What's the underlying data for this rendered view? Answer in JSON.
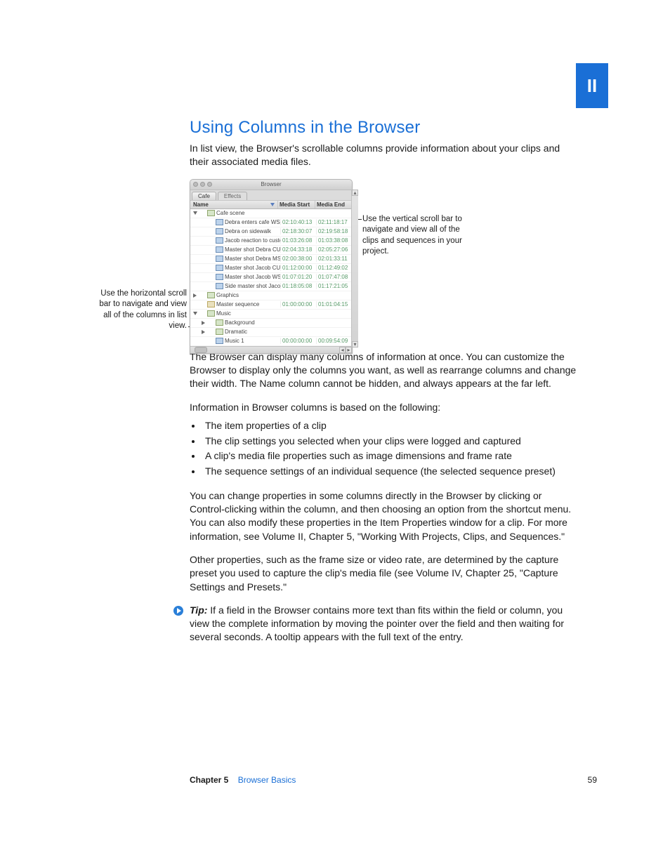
{
  "section_number": "II",
  "heading": "Using Columns in the Browser",
  "intro": "In list view, the Browser's scrollable columns provide information about your clips and their associated media files.",
  "callouts": {
    "left": "Use the horizontal scroll bar to navigate and view all of the columns in list view.",
    "right": "Use the vertical scroll bar to navigate and view all of the clips and sequences in your project."
  },
  "browser": {
    "window_title": "Browser",
    "tabs": [
      "Cafe",
      "Effects"
    ],
    "columns": {
      "name": "Name",
      "media_start": "Media Start",
      "media_end": "Media End"
    },
    "rows": [
      {
        "indent": 0,
        "tri": "down",
        "icon": "bin",
        "name": "Cafe scene",
        "start": "",
        "end": ""
      },
      {
        "indent": 1,
        "tri": "",
        "icon": "clip",
        "name": "Debra enters cafe WS",
        "start": "02:10:40:13",
        "end": "02:11:18:17"
      },
      {
        "indent": 1,
        "tri": "",
        "icon": "clip",
        "name": "Debra on sidewalk",
        "start": "02:18:30:07",
        "end": "02:19:58:18"
      },
      {
        "indent": 1,
        "tri": "",
        "icon": "clip",
        "name": "Jacob reaction to customer CU",
        "start": "01:03:26:08",
        "end": "01:03:38:08"
      },
      {
        "indent": 1,
        "tri": "",
        "icon": "clip",
        "name": "Master shot Debra CU",
        "start": "02:04:33:18",
        "end": "02:05:27:06"
      },
      {
        "indent": 1,
        "tri": "",
        "icon": "clip",
        "name": "Master shot Debra MS",
        "start": "02:00:38:00",
        "end": "02:01:33:11"
      },
      {
        "indent": 1,
        "tri": "",
        "icon": "clip",
        "name": "Master shot Jacob CU",
        "start": "01:12:00:00",
        "end": "01:12:49:02"
      },
      {
        "indent": 1,
        "tri": "",
        "icon": "clip",
        "name": "Master shot Jacob WS",
        "start": "01:07:01:20",
        "end": "01:07:47:08"
      },
      {
        "indent": 1,
        "tri": "",
        "icon": "clip",
        "name": "Side master shot Jacob MS",
        "start": "01:18:05:08",
        "end": "01:17:21:05"
      },
      {
        "indent": 0,
        "tri": "right",
        "icon": "bin",
        "name": "Graphics",
        "start": "",
        "end": ""
      },
      {
        "indent": 0,
        "tri": "",
        "icon": "seq",
        "name": "Master sequence",
        "start": "01:00:00:00",
        "end": "01:01:04:15"
      },
      {
        "indent": 0,
        "tri": "down",
        "icon": "bin",
        "name": "Music",
        "start": "",
        "end": ""
      },
      {
        "indent": 1,
        "tri": "right",
        "icon": "bin",
        "name": "Background",
        "start": "",
        "end": ""
      },
      {
        "indent": 1,
        "tri": "right",
        "icon": "bin",
        "name": "Dramatic",
        "start": "",
        "end": ""
      },
      {
        "indent": 1,
        "tri": "",
        "icon": "clip",
        "name": "Music 1",
        "start": "00:00:00:00",
        "end": "00:09:54:09"
      }
    ]
  },
  "para2": "The Browser can display many columns of information at once. You can customize the Browser to display only the columns you want, as well as rearrange columns and change their width. The Name column cannot be hidden, and always appears at the far left.",
  "para3": "Information in Browser columns is based on the following:",
  "bullets": [
    "The item properties of a clip",
    "The clip settings you selected when your clips were logged and captured",
    "A clip's media file properties such as image dimensions and frame rate",
    "The sequence settings of an individual sequence (the selected sequence preset)"
  ],
  "para4": "You can change properties in some columns directly in the Browser by clicking or Control-clicking within the column, and then choosing an option from the shortcut menu. You can also modify these properties in the Item Properties window for a clip. For more information, see Volume II, Chapter 5, \"Working With Projects, Clips, and Sequences.\"",
  "para5": "Other properties, such as the frame size or video rate, are determined by the capture preset you used to capture the clip's media file (see Volume IV, Chapter 25, \"Capture Settings and Presets.\"",
  "tip_label": "Tip:",
  "tip_body": "  If a field in the Browser contains more text than fits within the field or column, you view the complete information by moving the pointer over the field and then waiting for several seconds. A tooltip appears with the full text of the entry.",
  "footer": {
    "chapter_label": "Chapter 5",
    "chapter_title": "Browser Basics",
    "page": "59"
  }
}
